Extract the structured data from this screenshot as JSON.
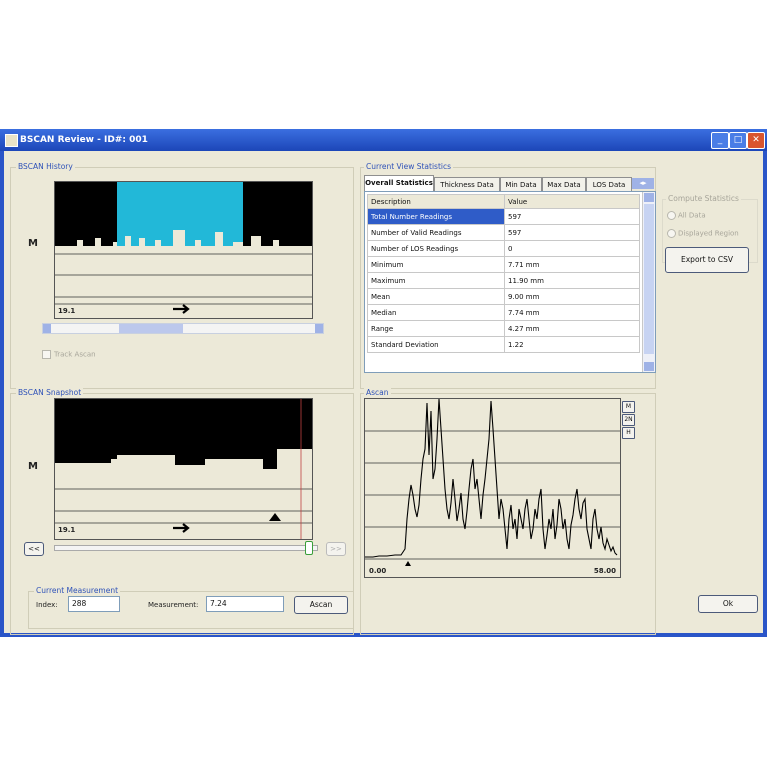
{
  "window": {
    "title": "BSCAN Review - ID#: 001"
  },
  "bscan_history": {
    "group_label": "BSCAN History",
    "m_label": "M",
    "footer_value": "19.1",
    "track_ascan_label": "Track Ascan"
  },
  "bscan_snapshot": {
    "group_label": "BSCAN Snapshot",
    "m_label": "M",
    "footer_value": "19.1",
    "rewind_label": "<<",
    "forward_label": ">>"
  },
  "current_measurement": {
    "group_label": "Current Measurement",
    "index_label": "Index:",
    "index_value": "288",
    "measurement_label": "Measurement:",
    "measurement_value": "7.24",
    "ascan_button": "Ascan"
  },
  "statistics": {
    "group_label": "Current View Statistics",
    "tabs": [
      "Overall Statistics",
      "Thickness Data",
      "Min Data",
      "Max Data",
      "LOS Data"
    ],
    "columns": [
      "Description",
      "Value"
    ],
    "rows": [
      {
        "desc": "Total Number Readings",
        "value": "597"
      },
      {
        "desc": "Number of Valid Readings",
        "value": "597"
      },
      {
        "desc": "Number of LOS Readings",
        "value": "0"
      },
      {
        "desc": "Minimum",
        "value": "7.71 mm"
      },
      {
        "desc": "Maximum",
        "value": "11.90 mm"
      },
      {
        "desc": "Mean",
        "value": "9.00 mm"
      },
      {
        "desc": "Median",
        "value": "7.74 mm"
      },
      {
        "desc": "Range",
        "value": "4.27 mm"
      },
      {
        "desc": "Standard Deviation",
        "value": "1.22"
      }
    ]
  },
  "compute_statistics": {
    "group_label": "Compute Statistics",
    "options": [
      "All Data",
      "Displayed Region"
    ],
    "export_button": "Export to CSV"
  },
  "ascan": {
    "group_label": "Ascan",
    "x_start": "0.00",
    "x_end": "58.00",
    "side_buttons": [
      "M",
      "2N",
      "H"
    ]
  },
  "ok_button": "Ok"
}
